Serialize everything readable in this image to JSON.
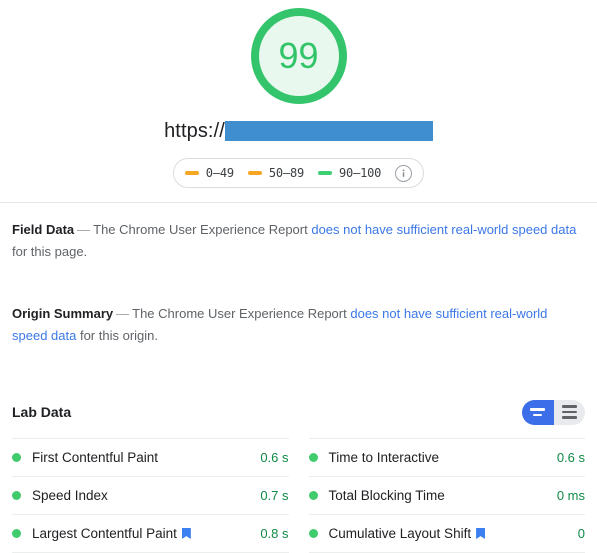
{
  "score": {
    "value": "99",
    "ring_color": "#34c46b",
    "fill_color": "#e8f8ee",
    "text_color": "#32c468"
  },
  "url": {
    "scheme": "https://",
    "redacted": true,
    "redaction_color": "#3f8ed0"
  },
  "legend": {
    "items": [
      {
        "label": "0–49",
        "color": "#f5a council"
      },
      {
        "label": "50–89",
        "color": "#f5a623"
      },
      {
        "label": "90–100",
        "color": "#3ecf74"
      }
    ],
    "info_icon": "info-icon"
  },
  "field_data": {
    "title": "Field Data",
    "dash": "—",
    "text_before": "The Chrome User Experience Report",
    "link": "does not have sufficient real-world speed data",
    "text_after": "for this page."
  },
  "origin_summary": {
    "title": "Origin Summary",
    "dash": "—",
    "text_before": "The Chrome User Experience Report",
    "link": "does not have sufficient real-world speed data",
    "text_after": "for this origin."
  },
  "lab_data": {
    "title": "Lab Data",
    "toggle": {
      "active": "compact-view",
      "options": [
        "compact-view",
        "list-view"
      ]
    },
    "columns": [
      {
        "rows": [
          {
            "name": "First Contentful Paint",
            "value": "0.6 s",
            "status": "good",
            "core_web_vital": false
          },
          {
            "name": "Speed Index",
            "value": "0.7 s",
            "status": "good",
            "core_web_vital": false
          },
          {
            "name": "Largest Contentful Paint",
            "value": "0.8 s",
            "status": "good",
            "core_web_vital": true
          }
        ]
      },
      {
        "rows": [
          {
            "name": "Time to Interactive",
            "value": "0.6 s",
            "status": "good",
            "core_web_vital": false
          },
          {
            "name": "Total Blocking Time",
            "value": "0 ms",
            "status": "good",
            "core_web_vital": false
          },
          {
            "name": "Cumulative Layout Shift",
            "value": "0",
            "status": "good",
            "core_web_vital": true
          }
        ]
      }
    ]
  },
  "colors": {
    "good_dot": "#40cb6c",
    "good_value": "#0f8a46",
    "link": "#3b78e7",
    "toggle_active": "#3b6ee8",
    "cwv_badge": "#3b7ff0"
  }
}
